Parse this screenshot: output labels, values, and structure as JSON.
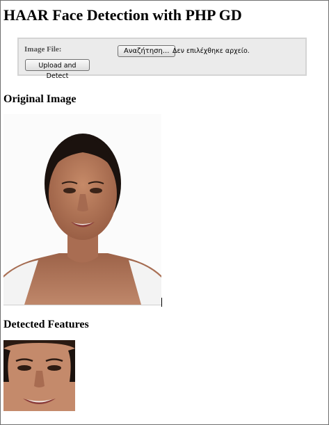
{
  "page": {
    "title": "HAAR Face Detection with PHP GD"
  },
  "form": {
    "image_file_label": "Image File:",
    "browse_label": "Αναζήτηση...",
    "no_file_text": "Δεν επιλέχθηκε αρχείο.",
    "upload_label": "Upload and Detect"
  },
  "sections": {
    "original": "Original Image",
    "detected": "Detected Features"
  }
}
